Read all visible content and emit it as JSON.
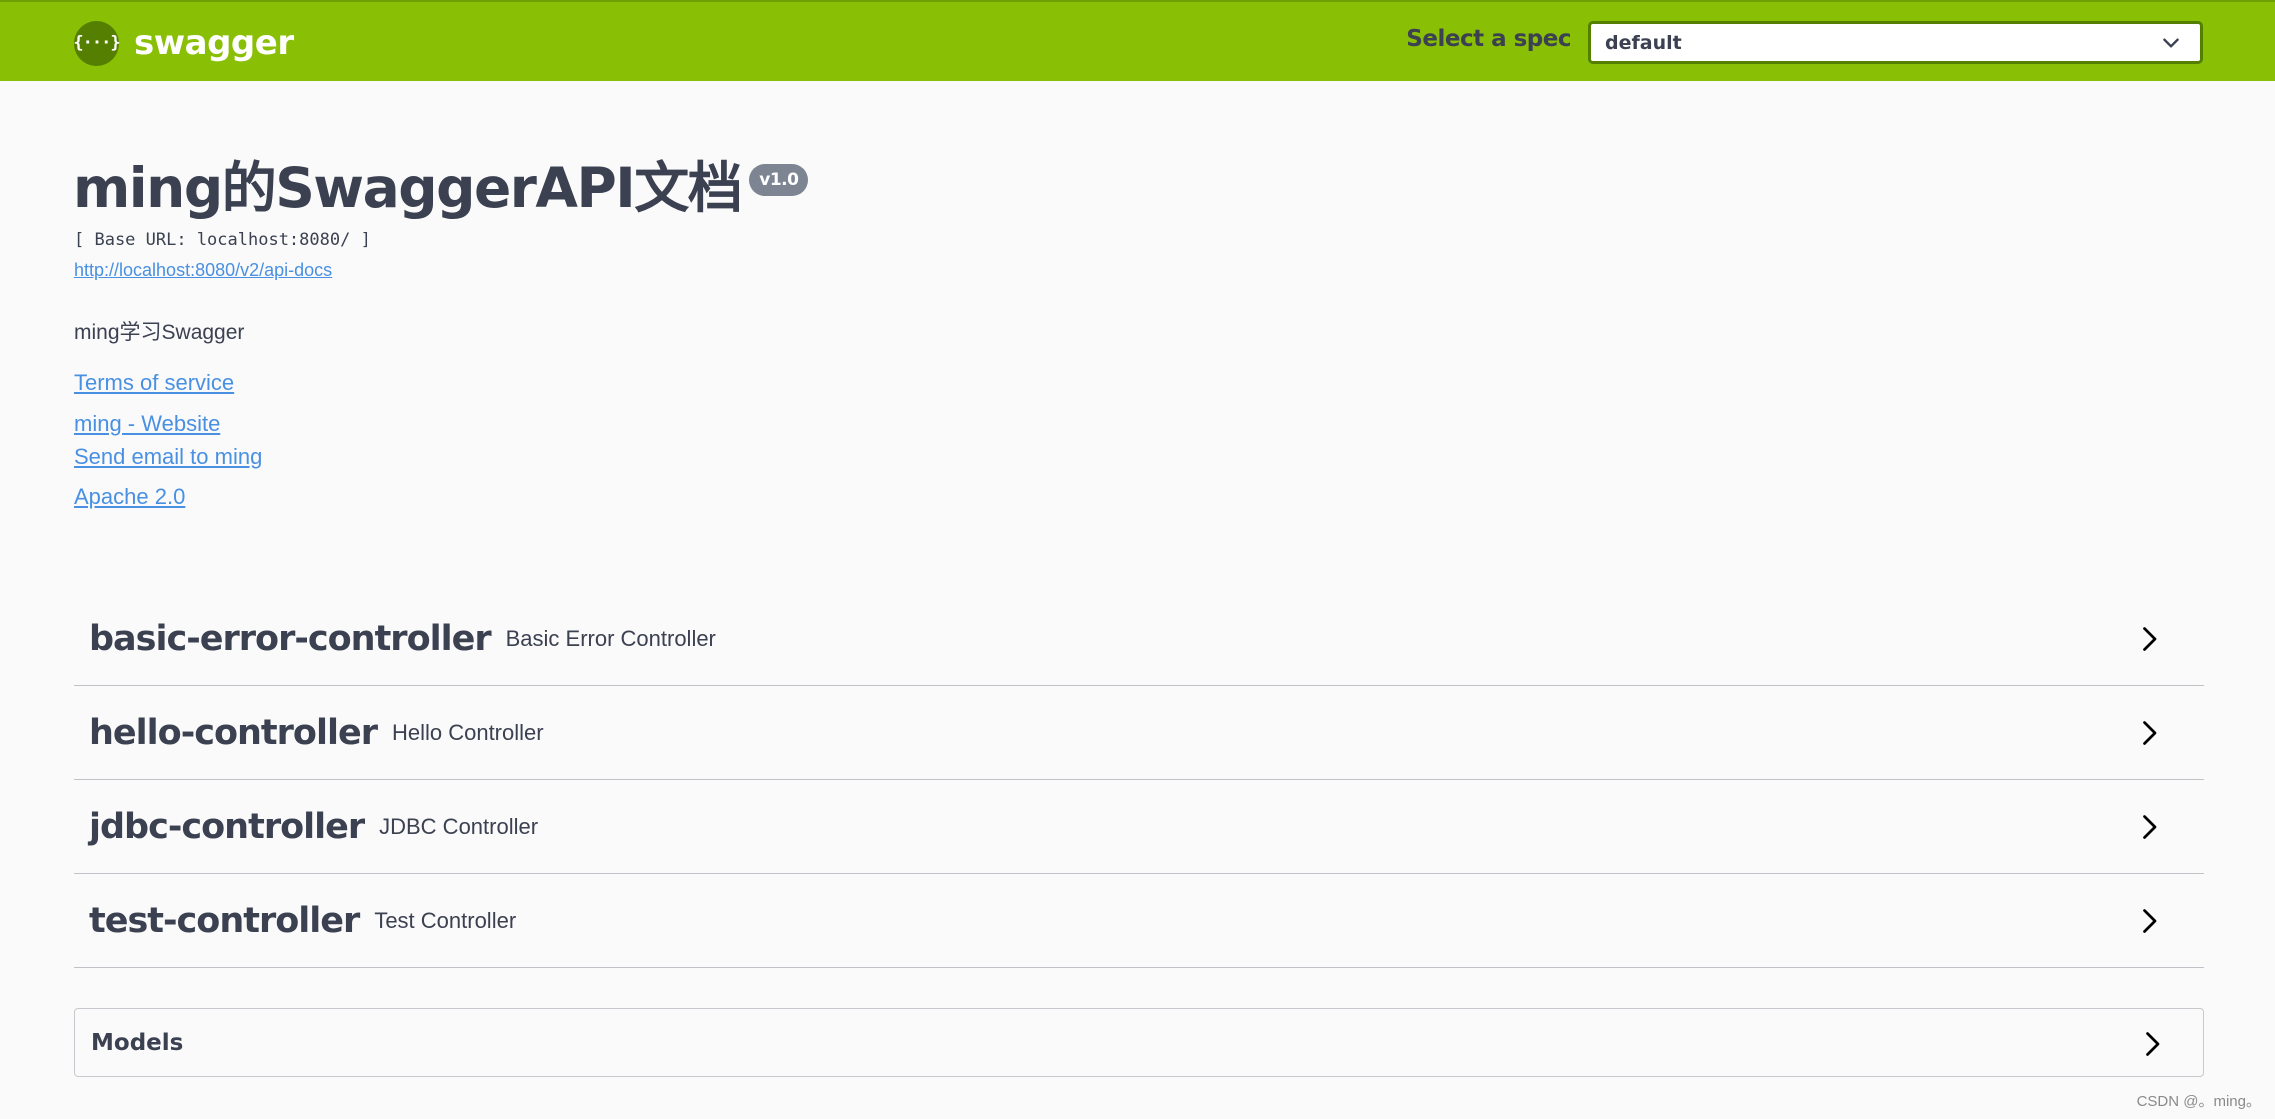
{
  "topbar": {
    "brand_logo_text": "{···}",
    "brand_name": "swagger",
    "spec_label": "Select a spec",
    "spec_selected": "default"
  },
  "info": {
    "title": "ming的SwaggerAPI文档",
    "version": "v1.0",
    "base_url": "[ Base URL: localhost:8080/ ]",
    "api_docs_link": "http://localhost:8080/v2/api-docs",
    "description": "ming学习Swagger",
    "terms_of_service": "Terms of service",
    "website": "ming - Website",
    "email": "Send email to ming",
    "license": "Apache 2.0"
  },
  "tags": [
    {
      "name": "basic-error-controller",
      "description": "Basic Error Controller"
    },
    {
      "name": "hello-controller",
      "description": "Hello Controller"
    },
    {
      "name": "jdbc-controller",
      "description": "JDBC Controller"
    },
    {
      "name": "test-controller",
      "description": "Test Controller"
    }
  ],
  "models": {
    "label": "Models"
  },
  "watermark": "CSDN @。ming。"
}
